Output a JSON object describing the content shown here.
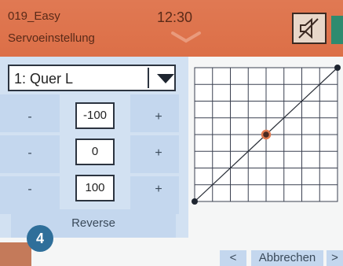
{
  "header": {
    "model_name": "019_Easy",
    "page_title": "Servoeinstellung",
    "time": "12:30",
    "mute_icon": "speaker-mute-icon",
    "battery_icon": "battery-icon",
    "accent_color": "#dc6f47"
  },
  "servo": {
    "selected": "1: Quer L",
    "dropdown_icon": "triangle-down-icon",
    "rows": [
      {
        "minus": "-",
        "value": "-100",
        "plus": "+"
      },
      {
        "minus": "-",
        "value": "0",
        "plus": "+"
      },
      {
        "minus": "-",
        "value": "100",
        "plus": "+"
      }
    ],
    "reverse_label": "Reverse"
  },
  "curve": {
    "grid_columns": 8,
    "grid_rows": 8,
    "points": [
      [
        -100,
        -100
      ],
      [
        0,
        0
      ],
      [
        100,
        100
      ]
    ],
    "marker_color": "#e07a50"
  },
  "footer": {
    "badge": "4",
    "prev_label": "<",
    "cancel_label": "Abbrechen",
    "next_label": ">"
  }
}
